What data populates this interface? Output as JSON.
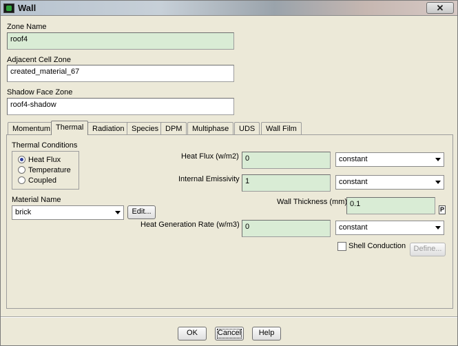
{
  "window": {
    "title": "Wall",
    "close_glyph": "✕",
    "icon": "app-icon"
  },
  "zone_name": {
    "label": "Zone Name",
    "value": "roof4"
  },
  "adjacent_cell_zone": {
    "label": "Adjacent Cell Zone",
    "value": "created_material_67"
  },
  "shadow_face_zone": {
    "label": "Shadow Face Zone",
    "value": "roof4-shadow"
  },
  "tabs": [
    {
      "label": "Momentum",
      "active": false
    },
    {
      "label": "Thermal",
      "active": true
    },
    {
      "label": "Radiation",
      "active": false
    },
    {
      "label": "Species",
      "active": false
    },
    {
      "label": "DPM",
      "active": false
    },
    {
      "label": "Multiphase",
      "active": false
    },
    {
      "label": "UDS",
      "active": false
    },
    {
      "label": "Wall Film",
      "active": false
    }
  ],
  "thermal_conditions": {
    "label": "Thermal Conditions",
    "options": [
      "Heat Flux",
      "Temperature",
      "Coupled"
    ],
    "selected": "Heat Flux"
  },
  "heat_flux": {
    "label": "Heat Flux (w/m2)",
    "value": "0",
    "method": "constant"
  },
  "internal_emissivity": {
    "label": "Internal Emissivity",
    "value": "1",
    "method": "constant"
  },
  "material": {
    "label": "Material Name",
    "value": "brick",
    "edit_label": "Edit..."
  },
  "wall_thickness": {
    "label": "Wall Thickness (mm)",
    "value": "0.1",
    "p_label": "P"
  },
  "heat_generation": {
    "label": "Heat Generation Rate (w/m3)",
    "value": "0",
    "method": "constant"
  },
  "shell_conduction": {
    "label": "Shell Conduction",
    "checked": false,
    "define_label": "Define..."
  },
  "footer": {
    "ok": "OK",
    "cancel": "Cancel",
    "help": "Help"
  }
}
